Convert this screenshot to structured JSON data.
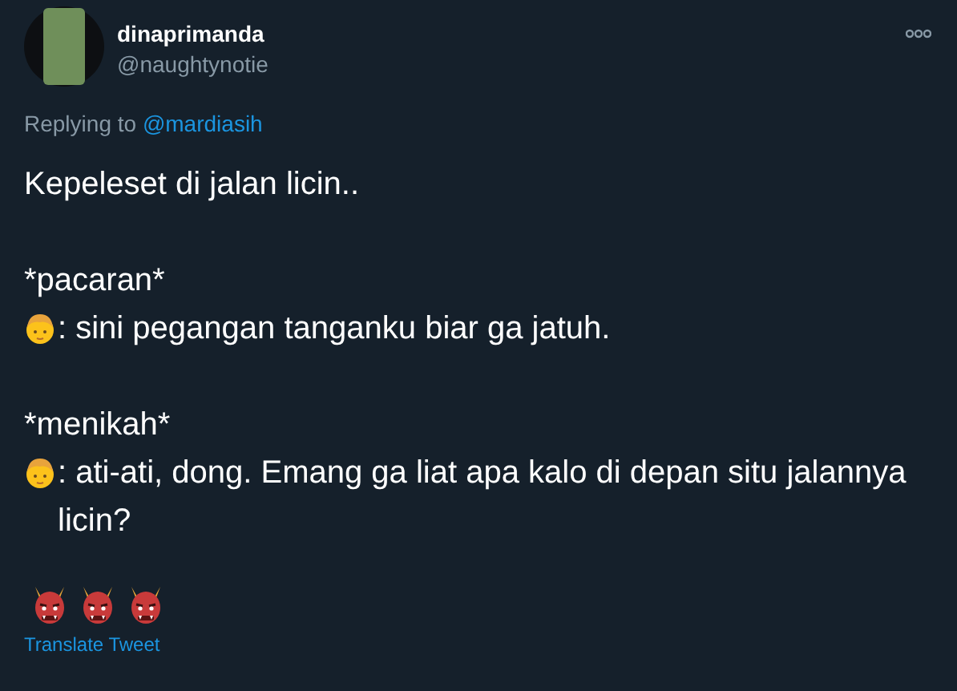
{
  "author": {
    "name": "dinaprimanda",
    "handle": "@naughtynotie"
  },
  "reply": {
    "label": "Replying to",
    "mention": "@mardiasih"
  },
  "paragraphs": [
    {
      "lines": [
        {
          "kind": "text",
          "text": "Kepeleset di jalan licin.."
        }
      ]
    },
    {
      "lines": [
        {
          "kind": "text",
          "text": "*pacaran*"
        },
        {
          "kind": "boy",
          "text": ": sini pegangan tanganku biar ga jatuh."
        }
      ]
    },
    {
      "lines": [
        {
          "kind": "text",
          "text": "*menikah*"
        },
        {
          "kind": "boy",
          "text": ": ati-ati, dong. Emang ga liat apa kalo di depan situ jalannya licin?"
        }
      ]
    }
  ],
  "translate": "Translate Tweet"
}
